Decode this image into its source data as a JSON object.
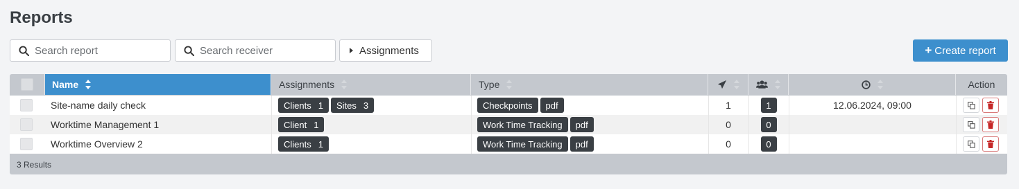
{
  "page": {
    "title": "Reports"
  },
  "toolbar": {
    "search_report_placeholder": "Search report",
    "search_receiver_placeholder": "Search receiver",
    "assignments_label": "Assignments",
    "create_label": "Create report",
    "accent_color": "#3d8fcd"
  },
  "table": {
    "headers": {
      "name": "Name",
      "assignments": "Assignments",
      "type": "Type",
      "sent_icon": "paper-plane-icon",
      "receivers_icon": "users-icon",
      "time_icon": "clock-icon",
      "action": "Action"
    },
    "sorted_column": "Name",
    "rows": [
      {
        "name": "Site-name daily check",
        "assignments": [
          {
            "label": "Clients",
            "count": "1"
          },
          {
            "label": "Sites",
            "count": "3"
          }
        ],
        "type": [
          "Checkpoints",
          "pdf"
        ],
        "sent": "1",
        "receivers": "1",
        "schedule": "12.06.2024, 09:00"
      },
      {
        "name": "Worktime Management 1",
        "assignments": [
          {
            "label": "Client",
            "count": "1"
          }
        ],
        "type": [
          "Work Time Tracking",
          "pdf"
        ],
        "sent": "0",
        "receivers": "0",
        "schedule": ""
      },
      {
        "name": "Worktime Overview 2",
        "assignments": [
          {
            "label": "Clients",
            "count": "1"
          }
        ],
        "type": [
          "Work Time Tracking",
          "pdf"
        ],
        "sent": "0",
        "receivers": "0",
        "schedule": ""
      }
    ],
    "footer": "3 Results"
  }
}
